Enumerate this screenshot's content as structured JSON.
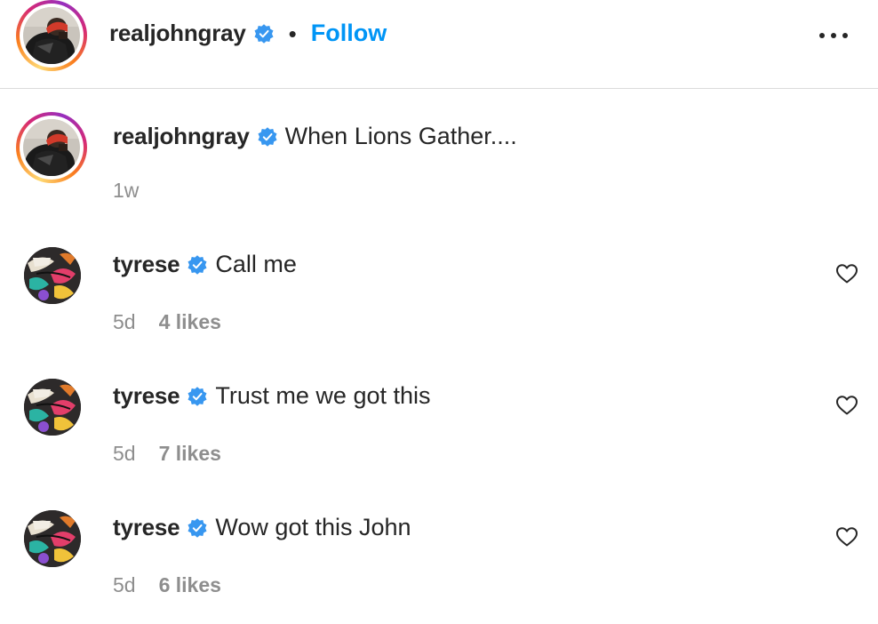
{
  "header": {
    "username": "realjohngray",
    "separator": "•",
    "follow_label": "Follow",
    "more_icon": "more-horizontal-icon"
  },
  "post": {
    "username": "realjohngray",
    "caption": "When Lions Gather....",
    "time": "1w"
  },
  "comments": [
    {
      "username": "tyrese",
      "text": "Call me",
      "time": "5d",
      "likes": "4 likes"
    },
    {
      "username": "tyrese",
      "text": "Trust me we got this",
      "time": "5d",
      "likes": "7 likes"
    },
    {
      "username": "tyrese",
      "text": "Wow got this John",
      "time": "5d",
      "likes": "6 likes"
    }
  ],
  "colors": {
    "follow": "#0095f6",
    "verified": "#3897f0",
    "muted": "#8e8e8e",
    "text": "#262626"
  }
}
